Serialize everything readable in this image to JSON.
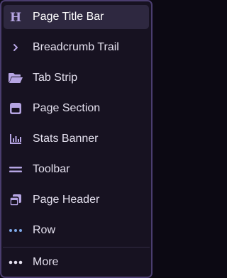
{
  "menu": {
    "items": [
      {
        "label": "Page Title Bar",
        "icon": "heading-icon",
        "active": true
      },
      {
        "label": "Breadcrumb Trail",
        "icon": "chevron-right-icon"
      },
      {
        "label": "Tab Strip",
        "icon": "folder-open-icon"
      },
      {
        "label": "Page Section",
        "icon": "section-card-icon"
      },
      {
        "label": "Stats Banner",
        "icon": "bar-chart-icon"
      },
      {
        "label": "Toolbar",
        "icon": "equals-bars-icon"
      },
      {
        "label": "Page Header",
        "icon": "stacked-windows-icon"
      },
      {
        "label": "Row",
        "icon": "dots-horizontal-icon"
      }
    ],
    "more": {
      "label": "More",
      "icon": "more-dots-icon"
    }
  },
  "colors": {
    "accent_icon": "#b6a5e3",
    "blue_dots": "#7ea7e6",
    "background": "#171221",
    "border": "#4a3d6e",
    "active_row": "#2e2840",
    "text": "#e4e0ee"
  }
}
